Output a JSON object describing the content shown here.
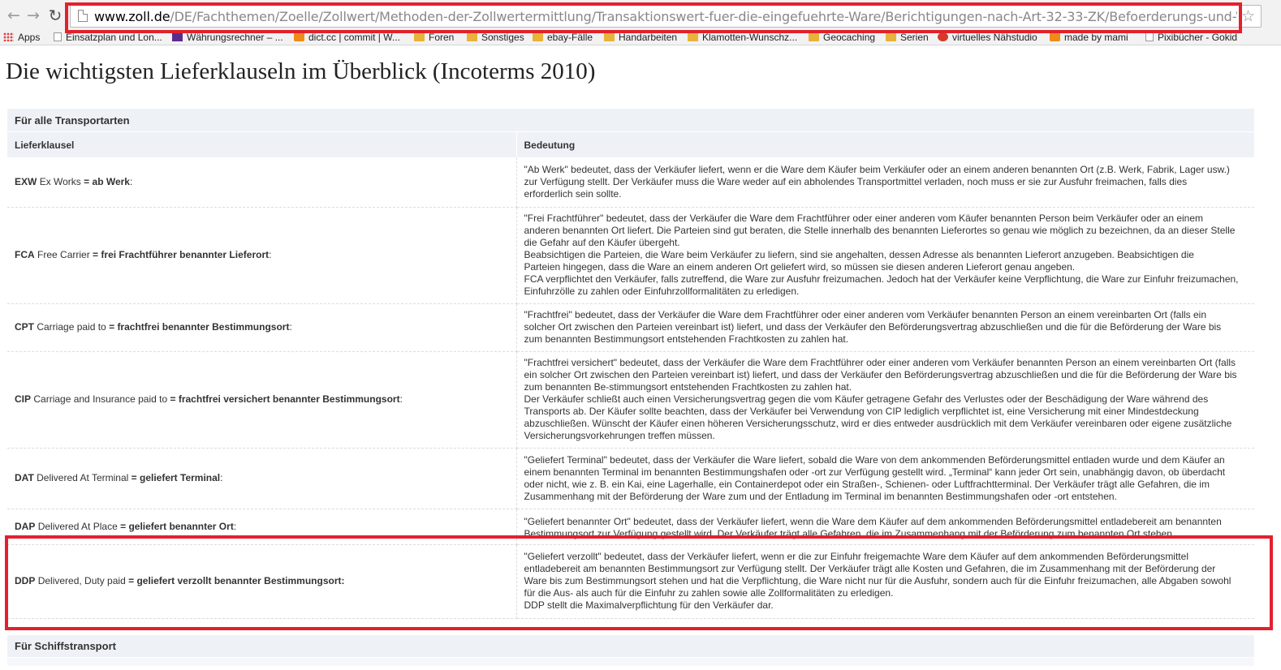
{
  "browser": {
    "url_domain": "www.zoll.de",
    "url_path": "/DE/Fachthemen/Zoelle/Zollwert/Methoden-der-Zollwertermittlung/Transaktionswert-fuer-die-eingefuehrte-Ware/Berichtigungen-nach-Art-32-33-ZK/Befoerderungs-und-Versicherungskosten/",
    "nav_icons": [
      "back-arrow-icon",
      "forward-arrow-icon",
      "reload-icon"
    ],
    "bookmarks": [
      {
        "label": "Apps",
        "icon": "apps-grid-icon"
      },
      {
        "label": "Einsatzplan und Lon...",
        "icon": "page-icon"
      },
      {
        "label": "Währungsrechner – ...",
        "icon": "t-logo-icon"
      },
      {
        "label": "dict.cc | commit | W...",
        "icon": "dict-icon"
      },
      {
        "label": "Foren",
        "icon": "folder-icon"
      },
      {
        "label": "Sonstiges",
        "icon": "folder-icon"
      },
      {
        "label": "ebay-Fälle",
        "icon": "folder-icon"
      },
      {
        "label": "Handarbeiten",
        "icon": "folder-icon"
      },
      {
        "label": "Klamotten-Wunschz...",
        "icon": "folder-icon"
      },
      {
        "label": "Geocaching",
        "icon": "folder-icon"
      },
      {
        "label": "Serien",
        "icon": "folder-icon"
      },
      {
        "label": "virtuelles Nähstudio",
        "icon": "site-icon"
      },
      {
        "label": "made by mami",
        "icon": "blogger-icon"
      },
      {
        "label": "Pixibücher - Gokid",
        "icon": "page-icon"
      }
    ]
  },
  "page": {
    "title": "Die wichtigsten Lieferklauseln im Überblick (Incoterms 2010)",
    "section_all": "Für alle Transportarten",
    "col_clause": "Lieferklausel",
    "col_meaning": "Bedeutung",
    "rows": [
      {
        "code": "EXW",
        "english": "Ex Works",
        "eq": "=",
        "german": "ab Werk",
        "colon": ":",
        "meaning": "\"Ab Werk\" bedeutet, dass der Verkäufer liefert, wenn er die Ware dem Käufer beim Verkäufer oder an einem anderen benannten Ort (z.B. Werk, Fabrik, Lager usw.)\nzur Verfügung stellt. Der Verkäufer muss die Ware weder auf ein abholendes Transportmittel verladen, noch muss er sie zur Ausfuhr freimachen, falls dies\nerforderlich sein sollte."
      },
      {
        "code": "FCA",
        "english": "Free Carrier",
        "eq": "=",
        "german": "frei Frachtführer benannter Lieferort",
        "colon": ":",
        "meaning": "\"Frei Frachtführer\" bedeutet, dass der Verkäufer die Ware dem Frachtführer oder einer anderen vom Käufer benannten Person beim Verkäufer oder an einem\nanderen benannten Ort liefert. Die Parteien sind gut beraten, die Stelle innerhalb des benannten Lieferortes so genau wie möglich zu bezeichnen, da an dieser Stelle\ndie Gefahr auf den Käufer übergeht.\nBeabsichtigen die Parteien, die Ware beim Verkäufer zu liefern, sind sie angehalten, dessen Adresse als benannten Lieferort anzugeben. Beabsichtigen die\nParteien hingegen, dass die Ware an einem anderen Ort geliefert wird, so müssen sie diesen anderen Lieferort genau angeben.\nFCA verpflichtet den Verkäufer, falls zutreffend, die Ware zur Ausfuhr freizumachen. Jedoch hat der Verkäufer keine Verpflichtung, die Ware zur Einfuhr freizumachen,\nEinfuhrzölle zu zahlen oder Einfuhrzollformalitäten zu erledigen."
      },
      {
        "code": "CPT",
        "english": "Carriage paid to",
        "eq": "=",
        "german": "frachtfrei benannter Bestimmungsort",
        "colon": ":",
        "meaning": "\"Frachtfrei\" bedeutet, dass der Verkäufer die Ware dem Frachtführer oder einer anderen vom Verkäufer benannten Person an einem vereinbarten Ort (falls ein\nsolcher Ort zwischen den Parteien vereinbart ist) liefert, und dass der Verkäufer den Beförderungsvertrag abzuschließen und die für die Beförderung der Ware bis\nzum benannten Bestimmungsort entstehenden Frachtkosten zu zahlen hat."
      },
      {
        "code": "CIP",
        "english": "Carriage and Insurance paid to",
        "eq": "=",
        "german": "frachtfrei versichert benannter Bestimmungsort",
        "colon": ":",
        "meaning": "\"Frachtfrei versichert\" bedeutet, dass der Verkäufer die Ware dem Frachtführer oder einer anderen vom Verkäufer benannten Person an einem vereinbarten Ort (falls\nein solcher Ort zwischen den Parteien vereinbart ist) liefert, und dass der Verkäufer den Beförderungsvertrag abzuschließen und die für die Beförderung der Ware bis\nzum benannten Be-stimmungsort entstehenden Frachtkosten zu zahlen hat.\nDer Verkäufer schließt auch einen Versicherungsvertrag gegen die vom Käufer getragene Gefahr des Verlustes oder der Beschädigung der Ware während des\nTransports ab. Der Käufer sollte beachten, dass der Verkäufer bei Verwendung von CIP lediglich verpflichtet ist, eine Versicherung mit einer Mindestdeckung\nabzuschließen. Wünscht der Käufer einen höheren Versicherungsschutz, wird er dies entweder ausdrücklich mit dem Verkäufer vereinbaren oder eigene zusätzliche\nVersicherungsvorkehrungen treffen müssen."
      },
      {
        "code": "DAT",
        "english": "Delivered At Terminal",
        "eq": "=",
        "german": "geliefert Terminal",
        "colon": ":",
        "meaning": "\"Geliefert Terminal\" bedeutet, dass der Verkäufer die Ware liefert, sobald die Ware von dem ankommenden Beförderungsmittel entladen wurde und dem Käufer an\neinem benannten Terminal im benannten Bestimmungshafen oder -ort zur Verfügung gestellt wird. „Terminal“ kann jeder Ort sein, unabhängig davon, ob überdacht\noder nicht, wie z. B. ein Kai, eine Lagerhalle, ein Containerdepot oder ein Straßen-, Schienen- oder Luftfrachtterminal. Der Verkäufer trägt alle Gefahren, die im\nZusammenhang mit der Beförderung der Ware zum und der Entladung im Terminal im benannten Bestimmungshafen oder -ort entstehen."
      },
      {
        "code": "DAP",
        "english": "Delivered At Place",
        "eq": "=",
        "german": "geliefert benannter Ort",
        "colon": ":",
        "meaning": "\"Geliefert benannter Ort\" bedeutet, dass der Verkäufer liefert, wenn die Ware dem Käufer auf dem ankommenden Beförderungsmittel entladebereit am benannten\nBestimmungsort zur Verfügung gestellt wird. Der Verkäufer trägt alle Gefahren, die im Zusammenhang mit der Beförderung zum benannten Ort stehen."
      },
      {
        "code": "DDP",
        "english": "Delivered, Duty paid",
        "eq": "=",
        "german": "geliefert verzollt benannter Bestimmungsort:",
        "colon": "",
        "meaning": "\"Geliefert verzollt\" bedeutet, dass der Verkäufer liefert, wenn er die zur Einfuhr freigemachte Ware dem Käufer auf dem ankommenden Beförderungsmittel\nentladebereit am benannten Bestimmungsort zur Verfügung stellt. Der Verkäufer trägt alle Kosten und Gefahren, die im Zusammenhang mit der Beförderung der\nWare bis zum Bestimmungsort stehen und hat die Verpflichtung, die Ware nicht nur für die Ausfuhr, sondern auch für die Einfuhr freizumachen, alle Abgaben sowohl\nfür die Aus- als auch für die Einfuhr zu zahlen sowie alle Zollformalitäten zu erledigen.\nDDP stellt die Maximalverpflichtung für den Verkäufer dar."
      }
    ],
    "section_ship": "Für Schiffstransport"
  },
  "colors": {
    "highlight": "#e3202d",
    "header_bg": "#eef2f7",
    "chrome_bg": "#f2f2f2"
  }
}
